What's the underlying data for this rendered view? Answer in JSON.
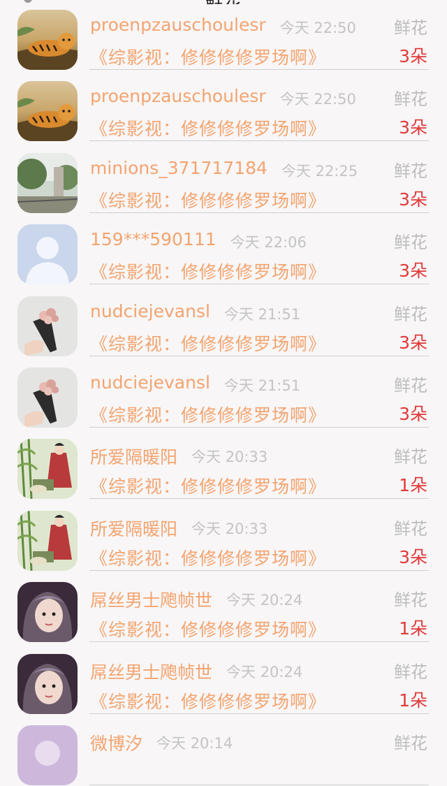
{
  "header": {
    "title": "鲜花"
  },
  "rows": [
    {
      "name": "proenpzauschoulesr",
      "time": "今天 22:50",
      "gift": "鲜花",
      "book": "《综影视：修修修修罗场啊》",
      "count": "3朵",
      "avatar": "tiger-avatar"
    },
    {
      "name": "proenpzauschoulesr",
      "time": "今天 22:50",
      "gift": "鲜花",
      "book": "《综影视：修修修修罗场啊》",
      "count": "3朵",
      "avatar": "tiger-avatar"
    },
    {
      "name": "minions_371717184",
      "time": "今天 22:25",
      "gift": "鲜花",
      "book": "《综影视：修修修修罗场啊》",
      "count": "3朵",
      "avatar": "garden-avatar"
    },
    {
      "name": "159***590111",
      "time": "今天 22:06",
      "gift": "鲜花",
      "book": "《综影视：修修修修罗场啊》",
      "count": "3朵",
      "avatar": "default-user-avatar"
    },
    {
      "name": "nudciejevansl",
      "time": "今天 21:51",
      "gift": "鲜花",
      "book": "《综影视：修修修修罗场啊》",
      "count": "3朵",
      "avatar": "bouquet-avatar"
    },
    {
      "name": "nudciejevansl",
      "time": "今天 21:51",
      "gift": "鲜花",
      "book": "《综影视：修修修修罗场啊》",
      "count": "3朵",
      "avatar": "bouquet-avatar"
    },
    {
      "name": "所爱隔暖阳",
      "time": "今天 20:33",
      "gift": "鲜花",
      "book": "《综影视：修修修修罗场啊》",
      "count": "1朵",
      "avatar": "painting-avatar"
    },
    {
      "name": "所爱隔暖阳",
      "time": "今天 20:33",
      "gift": "鲜花",
      "book": "《综影视：修修修修罗场啊》",
      "count": "3朵",
      "avatar": "painting-avatar"
    },
    {
      "name": "屌丝男士飑帧世",
      "time": "今天 20:24",
      "gift": "鲜花",
      "book": "《综影视：修修修修罗场啊》",
      "count": "1朵",
      "avatar": "girl-avatar"
    },
    {
      "name": "屌丝男士飑帧世",
      "time": "今天 20:24",
      "gift": "鲜花",
      "book": "《综影视：修修修修罗场啊》",
      "count": "1朵",
      "avatar": "girl-avatar"
    },
    {
      "name": "微博汐",
      "time": "今天 20:14",
      "gift": "鲜花",
      "book": "",
      "count": "",
      "avatar": "purple-avatar"
    }
  ],
  "colors": {
    "name": "#f3a46f",
    "count": "#e03a3a",
    "time": "#c4c4c4",
    "background": "#f8f6f7"
  }
}
